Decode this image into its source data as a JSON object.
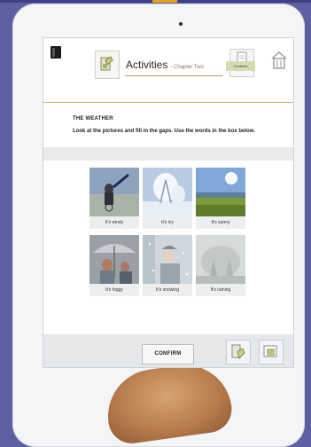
{
  "header": {
    "title": "Activities",
    "subtitle": "- Chapter Two",
    "chapter_badge": "Contents"
  },
  "exercise": {
    "section_title": "THE WEATHER",
    "instructions": "Look at the pictures and fill in the gaps. Use the words in the box below."
  },
  "tiles": [
    {
      "caption": "It's windy"
    },
    {
      "caption": "It's icy"
    },
    {
      "caption": "It's sunny"
    },
    {
      "caption": "It's foggy"
    },
    {
      "caption": "It's snowing"
    },
    {
      "caption": "It's raining"
    }
  ],
  "footer": {
    "confirm_label": "CONFIRM"
  },
  "icons": {
    "book": "book-icon",
    "activity": "activity-icon",
    "chapter": "chapter-icon",
    "home": "home-icon",
    "tool_left": "hand-pointer-icon",
    "tool_right": "gallery-icon"
  },
  "colors": {
    "background": "#5c5fa0",
    "accent": "#d7b86a",
    "badge": "#d5dbb3"
  }
}
